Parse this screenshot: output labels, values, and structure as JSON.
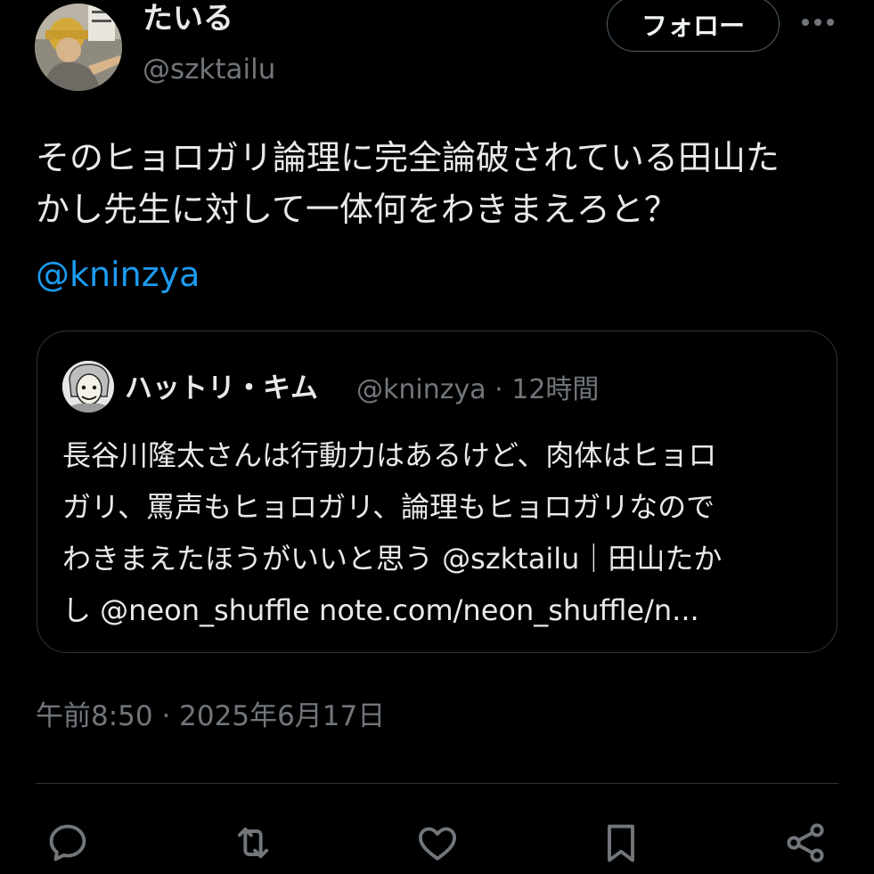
{
  "author": {
    "display_name": "たいる",
    "handle": "@szktailu",
    "avatar_icon": "user-avatar"
  },
  "header": {
    "follow_label": "フォロー",
    "more_icon": "more-horizontal-icon"
  },
  "tweet": {
    "text_lines": [
      "そのヒョロガリ論理に完全論破されている田山た",
      "かし先生に対して一体何をわきまえろと？"
    ],
    "mention": "@kninzya",
    "timestamp": "午前8:50 · 2025年6月17日"
  },
  "quote": {
    "author_name": "ハットリ・キム",
    "author_handle_time": "@kninzya · 12時間",
    "text_lines": [
      "長谷川隆太さんは行動力はあるけど、肉体はヒョロ",
      "ガリ、罵声もヒョロガリ、論理もヒョロガリなので",
      "わきまえたほうがいいと思う @szktailu｜田山たか",
      "し @neon_shuffle  note.com/neon_shuffle/n..."
    ]
  },
  "actions": [
    {
      "icon": "reply-icon"
    },
    {
      "icon": "retweet-icon"
    },
    {
      "icon": "like-icon"
    },
    {
      "icon": "bookmark-icon"
    },
    {
      "icon": "share-icon"
    }
  ],
  "colors": {
    "background": "#000000",
    "text_primary": "#e7e9ea",
    "text_secondary": "#71767b",
    "link": "#1d9bf0",
    "border": "#2f3336"
  }
}
